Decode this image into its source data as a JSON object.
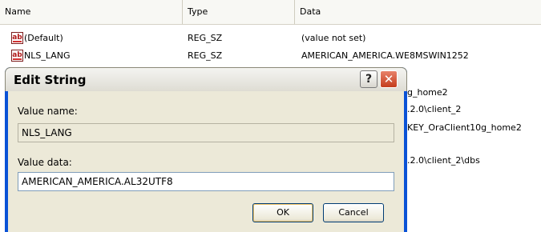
{
  "columns": {
    "name": "Name",
    "type": "Type",
    "data": "Data"
  },
  "rows": [
    {
      "icon": "ab",
      "name": "(Default)",
      "type": "REG_SZ",
      "data": "(value not set)"
    },
    {
      "icon": "ab",
      "name": "NLS_LANG",
      "type": "REG_SZ",
      "data": "AMERICAN_AMERICA.WE8MSWIN1252"
    }
  ],
  "background_fragments": [
    "g_home2",
    ".2.0\\client_2",
    "KEY_OraClient10g_home2",
    ".2.0\\client_2\\dbs"
  ],
  "dialog": {
    "title": "Edit String",
    "help_glyph": "?",
    "close_glyph": "✕",
    "value_name_label": "Value name:",
    "value_name": "NLS_LANG",
    "value_data_label": "Value data:",
    "value_data": "AMERICAN_AMERICA.AL32UTF8",
    "ok_label": "OK",
    "cancel_label": "Cancel"
  }
}
